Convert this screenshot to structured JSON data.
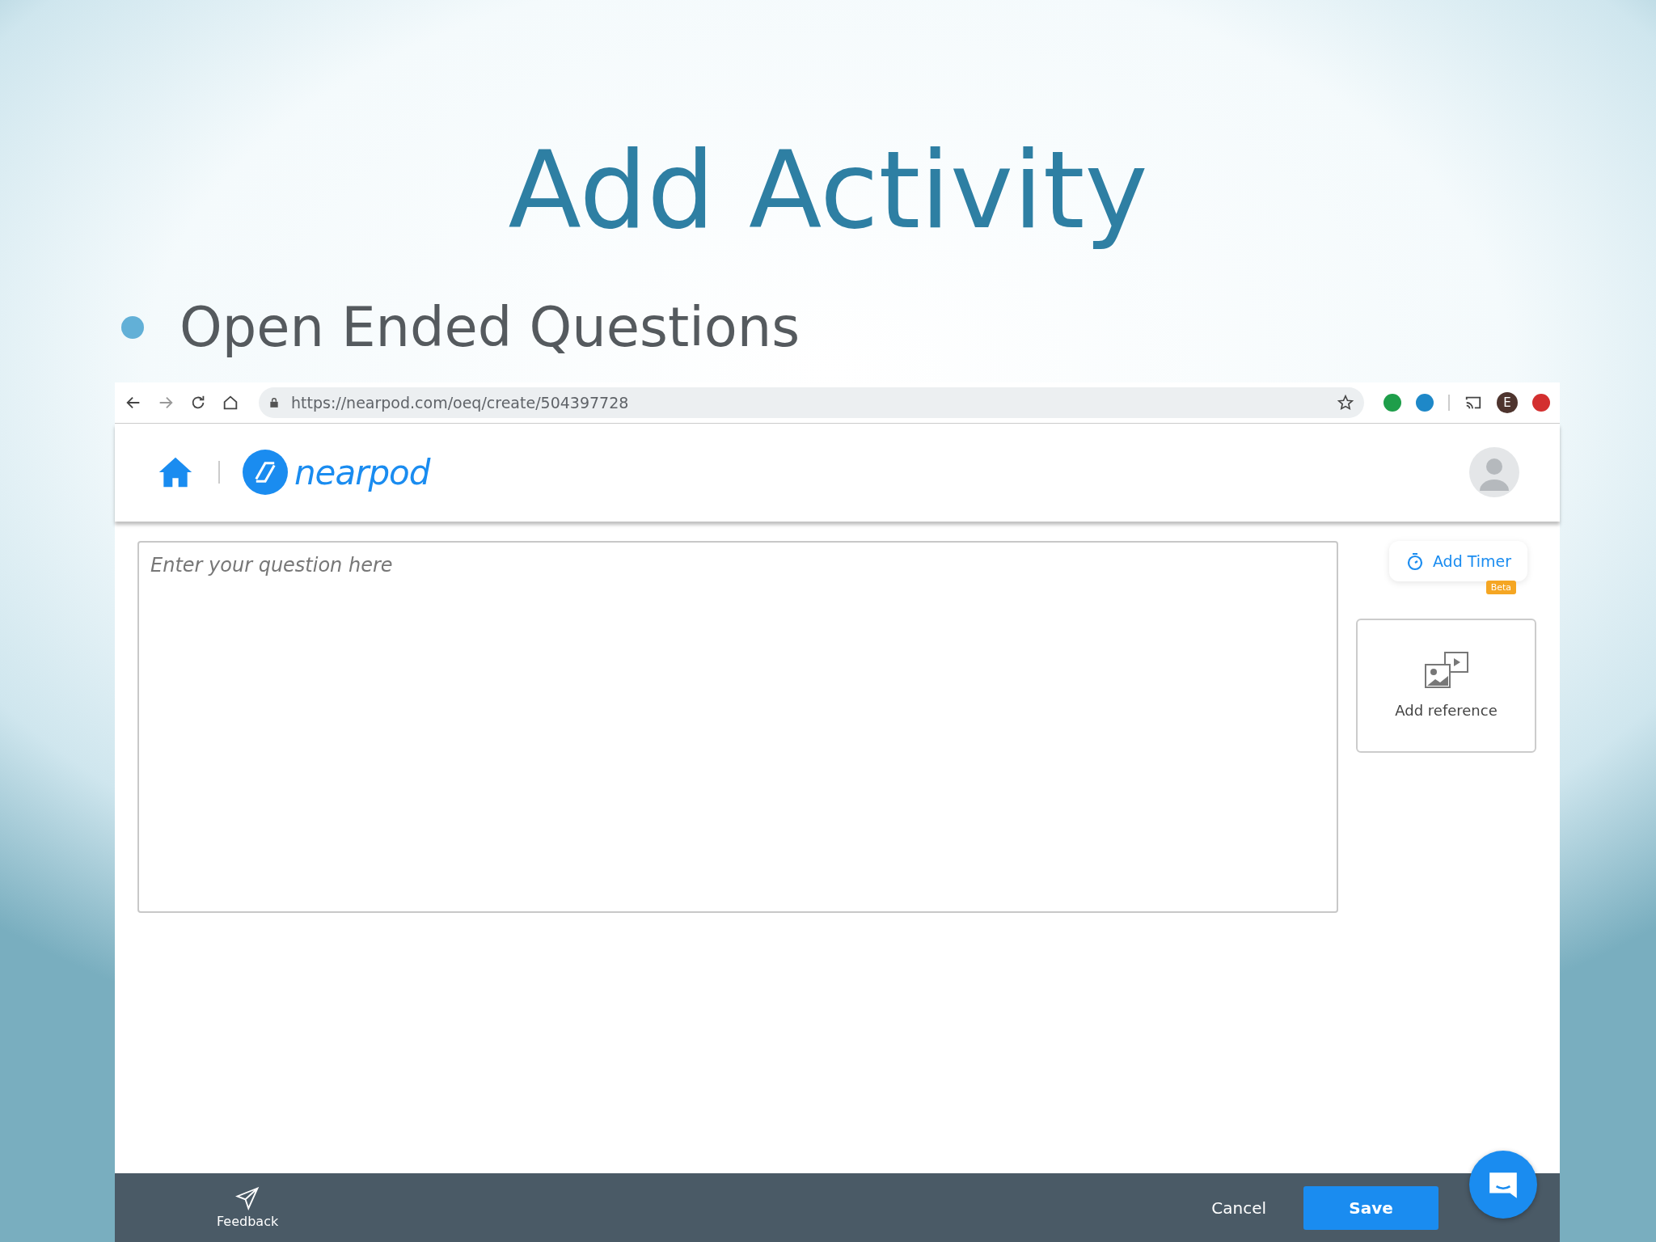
{
  "slide": {
    "title": "Add Activity",
    "bullets": [
      "Open Ended Questions"
    ]
  },
  "browser": {
    "url": "https://nearpod.com/oeq/create/504397728",
    "profile_initial": "E"
  },
  "app": {
    "logo_text": "nearpod",
    "question": {
      "placeholder": "Enter your question here"
    },
    "timer": {
      "label": "Add Timer",
      "badge": "Beta"
    },
    "reference": {
      "label": "Add reference"
    }
  },
  "footer": {
    "feedback": "Feedback",
    "cancel": "Cancel",
    "save": "Save"
  }
}
